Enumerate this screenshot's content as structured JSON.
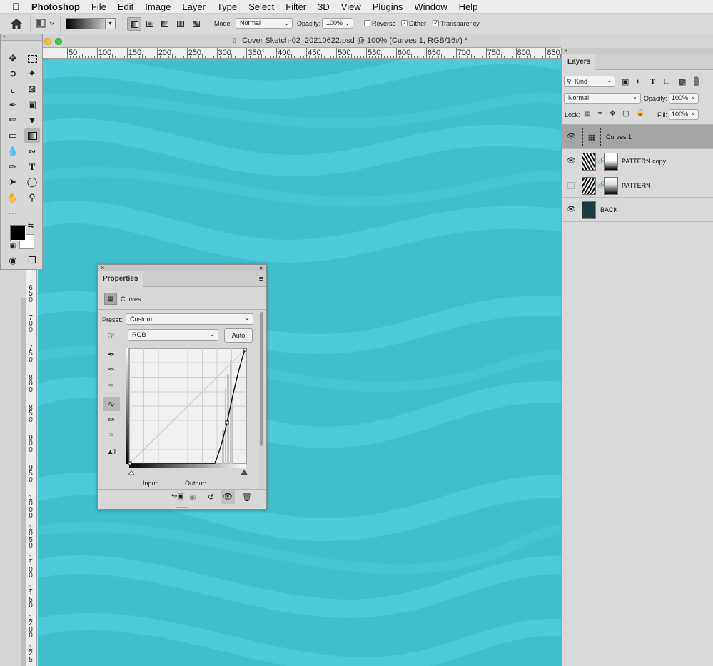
{
  "menubar": {
    "app": "Photoshop",
    "items": [
      "File",
      "Edit",
      "Image",
      "Layer",
      "Type",
      "Select",
      "Filter",
      "3D",
      "View",
      "Plugins",
      "Window",
      "Help"
    ]
  },
  "options": {
    "mode_label": "Mode:",
    "mode_value": "Normal",
    "opacity_label": "Opacity:",
    "opacity_value": "100%",
    "reverse_label": "Reverse",
    "dither_label": "Dither",
    "transparency_label": "Transparency",
    "reverse_checked": false,
    "dither_checked": true,
    "transparency_checked": true
  },
  "document": {
    "title": "Cover Sketch-02_20210622.psd @ 100% (Curves 1, RGB/16#) *"
  },
  "ruler": {
    "h_labels": [
      "50",
      "100",
      "150",
      "200",
      "250",
      "300",
      "350",
      "400",
      "450",
      "500",
      "550",
      "600",
      "650",
      "700",
      "750",
      "800",
      "850"
    ],
    "v_labels": [
      [
        "6",
        "5",
        "0"
      ],
      [
        "7",
        "0",
        "0"
      ],
      [
        "7",
        "5",
        "0"
      ],
      [
        "8",
        "0",
        "0"
      ],
      [
        "8",
        "5",
        "0"
      ],
      [
        "9",
        "0",
        "0"
      ],
      [
        "9",
        "5",
        "0"
      ],
      [
        "1",
        "0",
        "0",
        "0"
      ],
      [
        "1",
        "0",
        "5",
        "0"
      ],
      [
        "1",
        "1",
        "0",
        "0"
      ],
      [
        "1",
        "1",
        "5",
        "0"
      ],
      [
        "1",
        "2",
        "0",
        "0"
      ],
      [
        "1",
        "2",
        "5"
      ]
    ]
  },
  "layers_panel": {
    "tab": "Layers",
    "filter_kind": "Kind",
    "blend_mode": "Normal",
    "opacity_label": "Opacity:",
    "opacity_value": "100%",
    "lock_label": "Lock:",
    "fill_label": "Fill:",
    "fill_value": "100%",
    "layers": [
      {
        "name": "Curves 1",
        "visible": true,
        "selected": true
      },
      {
        "name": "PATTERN copy",
        "visible": true,
        "selected": false
      },
      {
        "name": "PATTERN",
        "visible": false,
        "selected": false
      },
      {
        "name": "BACK",
        "visible": true,
        "selected": false
      }
    ]
  },
  "properties_panel": {
    "tab": "Properties",
    "adjustment_title": "Curves",
    "preset_label": "Preset:",
    "preset_value": "Custom",
    "channel_value": "RGB",
    "auto_label": "Auto",
    "input_label": "Input:",
    "output_label": "Output:"
  },
  "colors": {
    "canvas_teal": "#3ec0cb",
    "stripe_teal": "#49ccd7",
    "foreground": "#000000",
    "background": "#ffffff",
    "back_layer_thumb": "#1e3a40"
  }
}
